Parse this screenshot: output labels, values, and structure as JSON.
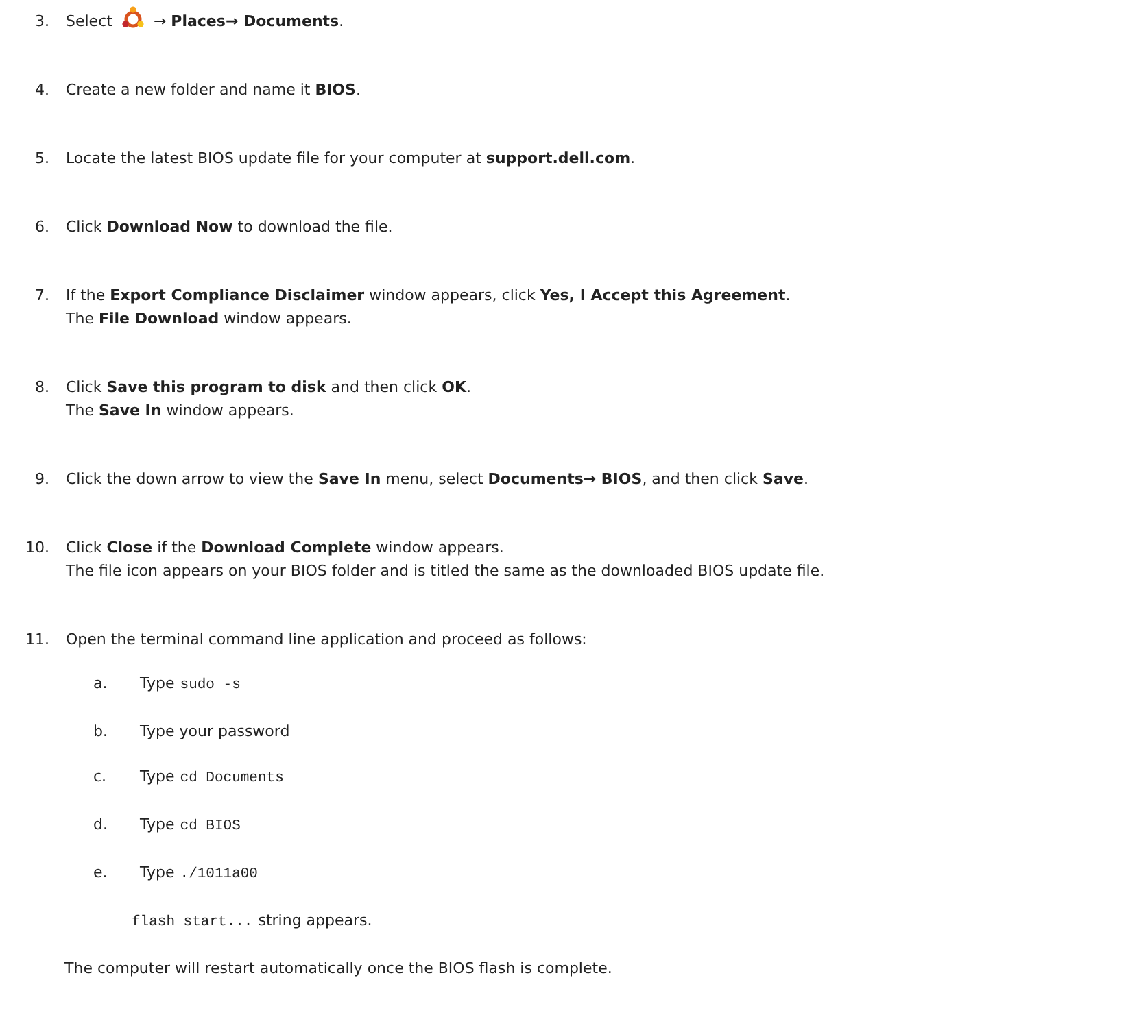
{
  "steps": [
    {
      "number": "3.",
      "kind": "icon",
      "before": "Select",
      "lines": [
        "→ **Places→ Documents**."
      ]
    },
    {
      "number": "4.",
      "kind": "text",
      "lines": [
        "Create a new folder and name it **BIOS**."
      ]
    },
    {
      "number": "5.",
      "kind": "text",
      "lines": [
        "Locate the latest BIOS update file for your computer at **support.dell.com**."
      ]
    },
    {
      "number": "6.",
      "kind": "text",
      "lines": [
        "Click **Download Now** to download the file."
      ]
    },
    {
      "number": "7.",
      "kind": "text",
      "lines": [
        "If the **Export Compliance Disclaimer** window appears, click **Yes, I Accept this Agreement**.",
        "The **File Download** window appears."
      ]
    },
    {
      "number": "8.",
      "kind": "text",
      "lines": [
        "Click **Save this program to disk** and then click **OK**.",
        "The **Save In** window appears."
      ]
    },
    {
      "number": "9.",
      "kind": "text",
      "lines": [
        "Click the down arrow to view the **Save In** menu, select **Documents→ BIOS**, and then click **Save**."
      ]
    },
    {
      "number": "10.",
      "kind": "text",
      "lines": [
        "Click **Close** if the **Download Complete** window appears.",
        "The file icon appears on your BIOS folder and is titled the same as the downloaded BIOS update file."
      ]
    },
    {
      "number": "11.",
      "kind": "text",
      "lines": [
        "Open the terminal command line application and proceed as follows:"
      ]
    }
  ],
  "substeps": [
    {
      "letter": "a.",
      "text": "Type",
      "code": "sudo -s"
    },
    {
      "letter": "b.",
      "text": "Type your password"
    },
    {
      "letter": "c.",
      "text": "Type",
      "code": "cd Documents"
    },
    {
      "letter": "d.",
      "text": "Type",
      "code": "cd BIOS"
    },
    {
      "letter": "e.",
      "text": "Type",
      "code": "./1011a00"
    }
  ],
  "result": {
    "code": "flash start...",
    "text": "string appears."
  },
  "closing": "The computer will restart automatically once the BIOS flash is complete."
}
